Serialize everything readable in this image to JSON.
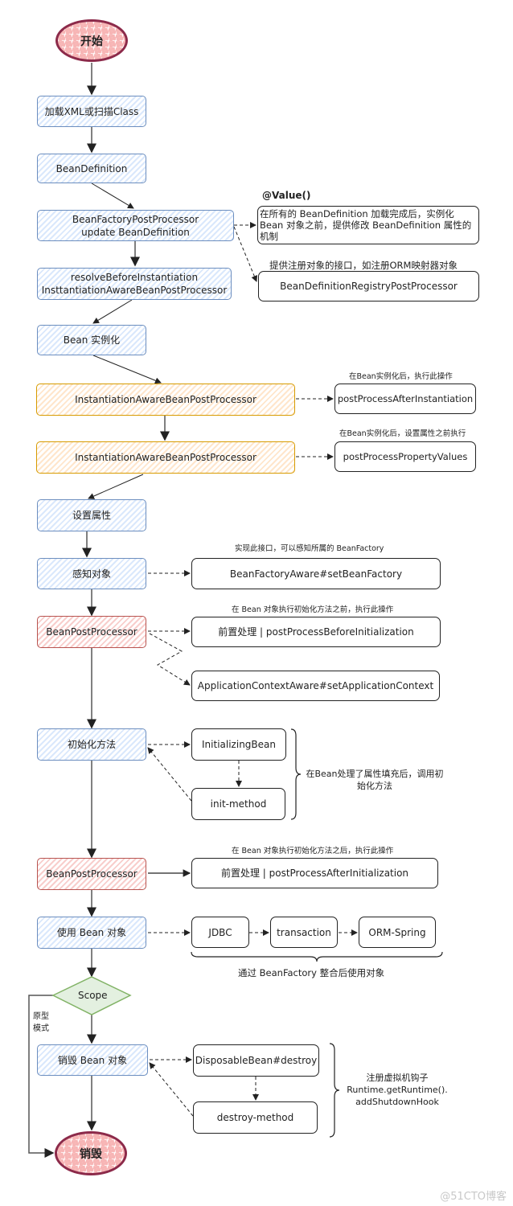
{
  "diagram": {
    "start": "开始",
    "end": "销毁",
    "main_flow": [
      {
        "id": "load",
        "label": "加载XML或扫描Class",
        "color": "blue"
      },
      {
        "id": "beandef",
        "label": "BeanDefinition",
        "color": "blue"
      },
      {
        "id": "bfpp",
        "label": "BeanFactoryPostProcessor\nupdate BeanDefinition",
        "color": "blue"
      },
      {
        "id": "resolve",
        "label": "resolveBeforeInstantiation\nInsttantiationAwareBeanPostProcessor",
        "color": "blue"
      },
      {
        "id": "instantiate",
        "label": "Bean 实例化",
        "color": "blue"
      },
      {
        "id": "iabpp1",
        "label": "InstantiationAwareBeanPostProcessor",
        "color": "orange"
      },
      {
        "id": "iabpp2",
        "label": "InstantiationAwareBeanPostProcessor",
        "color": "orange"
      },
      {
        "id": "setprops",
        "label": "设置属性",
        "color": "blue"
      },
      {
        "id": "aware",
        "label": "感知对象",
        "color": "blue"
      },
      {
        "id": "bpp1",
        "label": "BeanPostProcessor",
        "color": "red"
      },
      {
        "id": "init",
        "label": "初始化方法",
        "color": "blue"
      },
      {
        "id": "bpp2",
        "label": "BeanPostProcessor",
        "color": "red"
      },
      {
        "id": "use",
        "label": "使用 Bean 对象",
        "color": "blue"
      },
      {
        "id": "scope",
        "label": "Scope",
        "color": "green"
      },
      {
        "id": "destroy",
        "label": "销毁 Bean 对象",
        "color": "blue"
      }
    ],
    "side_nodes": {
      "value_annotation": "@Value()",
      "bfpp_note": "在所有的 BeanDefinition 加载完成后，实例化 Bean 对象之前，提供修改 BeanDefinition 属性的机制",
      "registry_caption": "提供注册对象的接口，如注册ORM映射器对象",
      "registry": "BeanDefinitionRegistryPostProcessor",
      "after_inst_caption": "在Bean实例化后，执行此操作",
      "after_inst": "postProcessAfterInstantiation",
      "prop_values_caption": "在Bean实例化后，设置属性之前执行",
      "prop_values": "postProcessPropertyValues",
      "aware_caption": "实现此接口，可以感知所属的 BeanFactory",
      "aware_target": "BeanFactoryAware#setBeanFactory",
      "before_init_caption": "在 Bean 对象执行初始化方法之前，执行此操作",
      "before_init": "前置处理 | postProcessBeforeInitialization",
      "app_context": "ApplicationContextAware#setApplicationContext",
      "initializing_bean": "InitializingBean",
      "init_method": "init-method",
      "init_brace_note": "在Bean处理了属性填充后，调用初始化方法",
      "after_init_caption": "在 Bean 对象执行初始化方法之后，执行此操作",
      "after_init": "前置处理 | postProcessAfterInitialization",
      "jdbc": "JDBC",
      "transaction": "transaction",
      "orm": "ORM-Spring",
      "use_brace_note": "通过 BeanFactory 整合后使用对象",
      "disposable": "DisposableBean#destroy",
      "destroy_method": "destroy-method",
      "destroy_brace_note": "注册虚拟机钩子\nRuntime.getRuntime().\naddShutdownHook",
      "prototype_label": "原型\n模式"
    },
    "colors": {
      "blue_stroke": "#6c8ebf",
      "blue_fill": "#dae8fc",
      "orange_stroke": "#d79b00",
      "orange_fill": "#ffe6cc",
      "red_stroke": "#b85450",
      "red_fill": "#f8cecc",
      "green_stroke": "#82b366",
      "green_fill": "#d5e8d4",
      "terminal_stroke": "#8c2a4a"
    }
  },
  "watermark": "@51CTO博客"
}
